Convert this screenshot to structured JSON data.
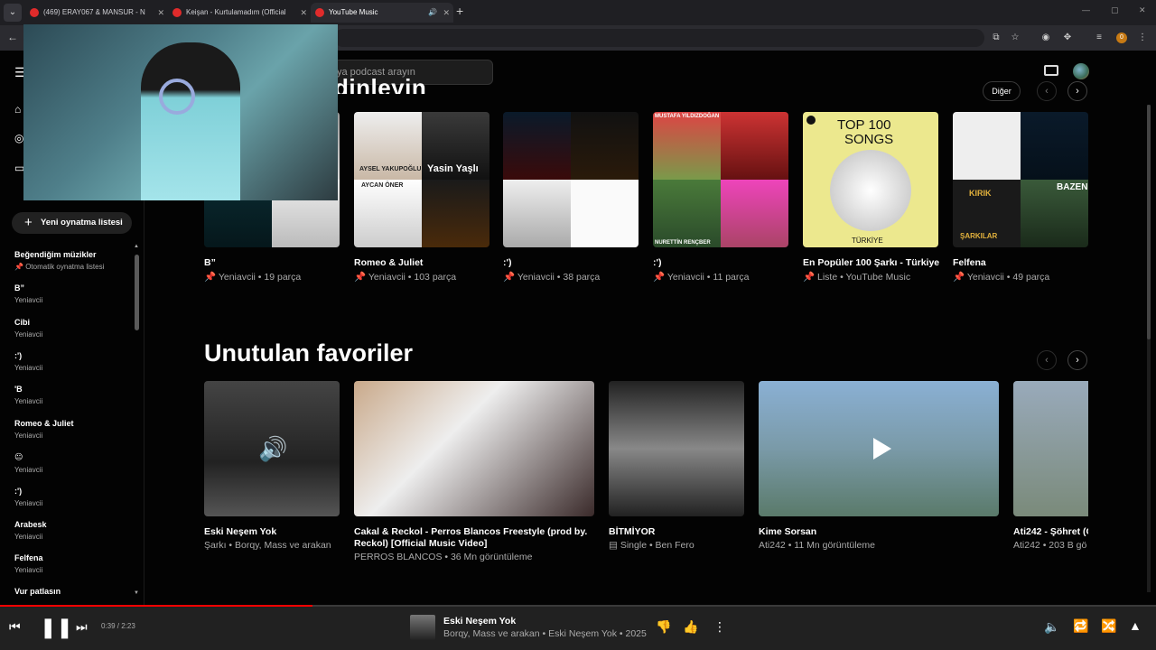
{
  "browser": {
    "tabs": [
      {
        "title": "(469) ERAY067 & MANSUR - N",
        "active": false
      },
      {
        "title": "Keişan - Kurtulamadım (Official",
        "active": false
      },
      {
        "title": "YouTube Music",
        "active": true
      }
    ],
    "new_tab": "+",
    "extension_badge": "0"
  },
  "header": {
    "search_placeholder": "ya podcast arayın"
  },
  "sidebar": {
    "new_playlist_label": "Yeni oynatma listesi",
    "playlists": [
      {
        "title": "Beğendiğim müzikler",
        "subtitle": "Otomatik oynatma listesi"
      },
      {
        "title": "B”",
        "subtitle": "Yeniavcii"
      },
      {
        "title": "Cibi",
        "subtitle": "Yeniavcii"
      },
      {
        "title": ":')",
        "subtitle": "Yeniavcii"
      },
      {
        "title": "'B",
        "subtitle": "Yeniavcii"
      },
      {
        "title": "Romeo & Juliet",
        "subtitle": "Yeniavcii"
      },
      {
        "title": "😐",
        "subtitle": "Yeniavcii"
      },
      {
        "title": ":')",
        "subtitle": "Yeniavcii"
      },
      {
        "title": "Arabesk",
        "subtitle": "Yeniavcii"
      },
      {
        "title": "Felfena",
        "subtitle": "Yeniavcii"
      },
      {
        "title": "Vur patlasın",
        "subtitle": ""
      }
    ]
  },
  "section1": {
    "title_partial": "dinleyin",
    "more_label": "Diğer",
    "cards": [
      {
        "title": "B”",
        "subtitle": "Yeniavcii • 19 parça"
      },
      {
        "title": "Romeo & Juliet",
        "subtitle": "Yeniavcii • 103 parça"
      },
      {
        "title": ":')",
        "subtitle": "Yeniavcii • 38 parça"
      },
      {
        "title": ":')",
        "subtitle": "Yeniavcii • 11 parça"
      },
      {
        "title": "En Popüler 100 Şarkı - Türkiye",
        "subtitle": "Liste • YouTube Music"
      },
      {
        "title": "Felfena",
        "subtitle": "Yeniavcii • 49 parça"
      }
    ],
    "art_text": {
      "aysel": "AYSEL YAKUPOĞLU",
      "yasin": "Yasin Yaşlı",
      "aycan": "AYCAN ÖNER",
      "mustafa": "MUSTAFA YILDIZDOĞAN",
      "nurettin": "NURETTİN RENÇBER",
      "top": "TOP 100",
      "songs": "SONGS",
      "turkiye": "TÜRKİYE",
      "kirik": "KIRIK",
      "sarkilar": "ŞARKILAR",
      "bazen": "BAZEN"
    }
  },
  "section2": {
    "title": "Unutulan favoriler",
    "cards": [
      {
        "title": "Eski Neşem Yok",
        "subtitle": "Şarkı • Borqy, Mass ve arakan"
      },
      {
        "title": "Cakal & Reckol - Perros Blancos Freestyle (prod by. Reckol) [Official Music Video]",
        "subtitle": "PERROS BLANCOS • 36 Mn görüntüleme"
      },
      {
        "title": "BİTMİYOR",
        "subtitle": "Single • Ben Fero"
      },
      {
        "title": "Kime Sorsan",
        "subtitle": "Ati242 • 11 Mn görüntüleme"
      },
      {
        "title": "Ati242 - Şöhret (O",
        "subtitle": "Ati242 • 203 B gö"
      }
    ]
  },
  "player": {
    "time": "0:39 / 2:23",
    "progress": 0.27,
    "title": "Eski Neşem Yok",
    "subtitle": "Borqy, Mass ve arakan • Eski Neşem Yok • 2025"
  }
}
